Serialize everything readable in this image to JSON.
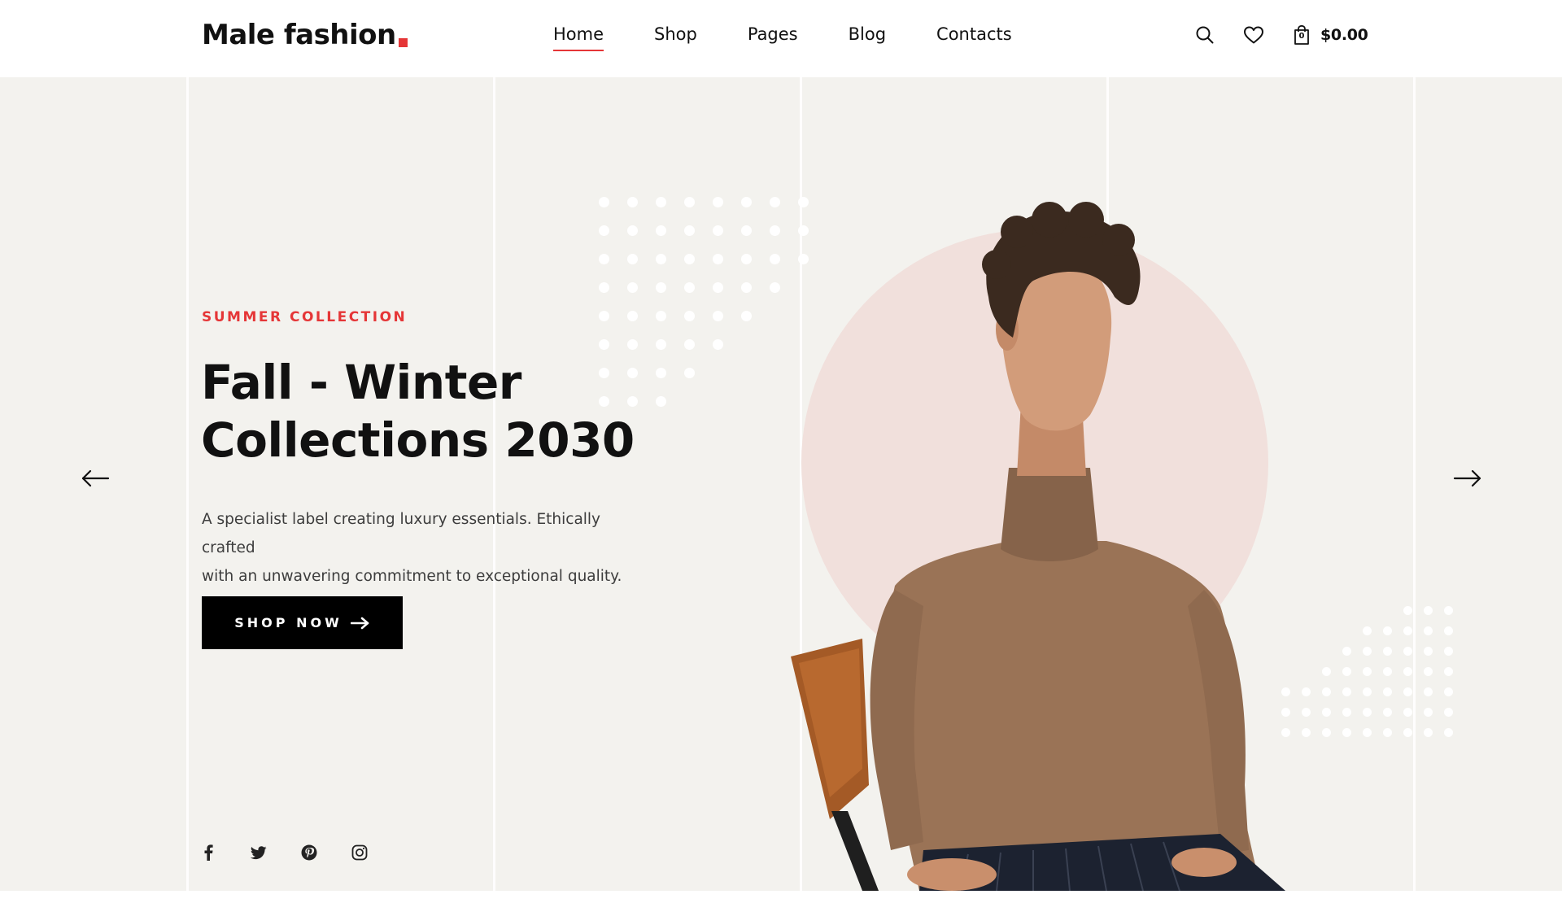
{
  "header": {
    "logo_text": "Male fashion",
    "nav": [
      {
        "label": "Home",
        "active": true
      },
      {
        "label": "Shop",
        "active": false
      },
      {
        "label": "Pages",
        "active": false
      },
      {
        "label": "Blog",
        "active": false
      },
      {
        "label": "Contacts",
        "active": false
      }
    ],
    "icons": [
      "search-icon",
      "heart-icon",
      "shopping-bag-icon"
    ],
    "cart_count": "0",
    "cart_price": "$0.00"
  },
  "hero": {
    "subtitle": "SUMMER COLLECTION",
    "title_line1": "Fall - Winter",
    "title_line2": "Collections 2030",
    "description_line1": "A specialist label creating luxury essentials. Ethically crafted",
    "description_line2": "with an unwavering commitment to exceptional quality.",
    "button_label": "SHOP NOW",
    "prev_icon": "arrow-left-icon",
    "next_icon": "arrow-right-icon",
    "socials": [
      "facebook-icon",
      "twitter-icon",
      "pinterest-icon",
      "instagram-icon"
    ]
  },
  "colors": {
    "accent": "#e53637",
    "hero_bg": "#f3f2ee",
    "circle": "#f1e0dc",
    "button_bg": "#000000",
    "sweater": "#9a7356"
  }
}
